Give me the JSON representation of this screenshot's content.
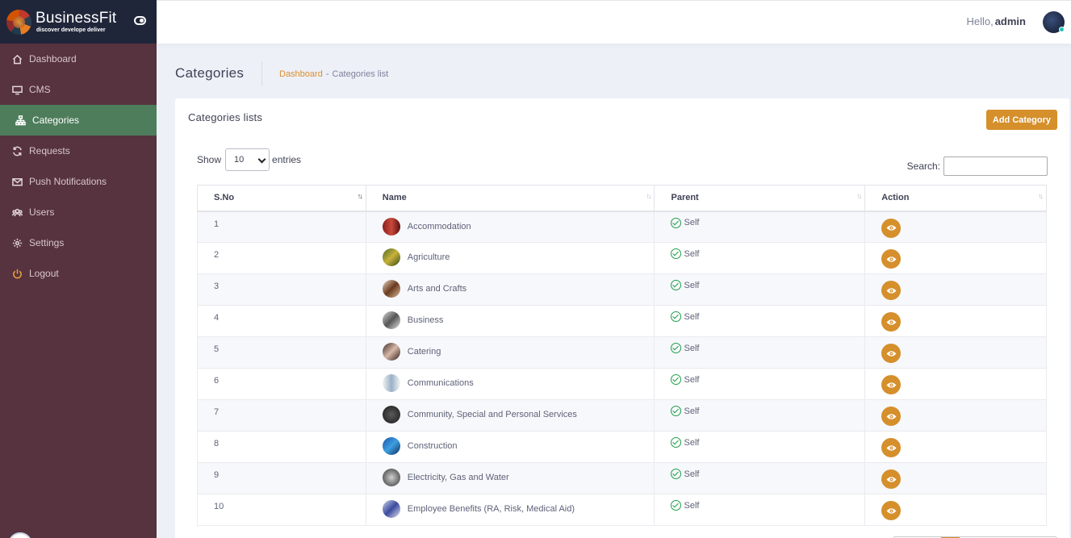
{
  "brand": {
    "name": "BusinessFit",
    "tagline": "discover develope deliver"
  },
  "sidebar": {
    "items": [
      {
        "label": "Dashboard",
        "icon": "home-icon"
      },
      {
        "label": "CMS",
        "icon": "monitor-icon"
      },
      {
        "label": "Categories",
        "icon": "sitemap-icon",
        "active": true
      },
      {
        "label": "Requests",
        "icon": "refresh-icon"
      },
      {
        "label": "Push Notifications",
        "icon": "envelope-icon"
      },
      {
        "label": "Users",
        "icon": "users-icon"
      },
      {
        "label": "Settings",
        "icon": "gear-icon"
      },
      {
        "label": "Logout",
        "icon": "power-icon"
      }
    ]
  },
  "header": {
    "hello": "Hello,",
    "username": "admin"
  },
  "subheader": {
    "title": "Categories",
    "breadcrumb_link": "Dashboard",
    "breadcrumb_sep": "-",
    "breadcrumb_current": "Categories list"
  },
  "card": {
    "title": "Categories lists",
    "add_label": "Add Category",
    "show_label": "Show",
    "entries_value": "10",
    "entries_label": "entries",
    "search_label": "Search:"
  },
  "table": {
    "columns": [
      "S.No",
      "Name",
      "Parent",
      "Action"
    ],
    "rows": [
      {
        "sno": "1",
        "name": "Accommodation",
        "parent": "Self"
      },
      {
        "sno": "2",
        "name": "Agriculture",
        "parent": "Self"
      },
      {
        "sno": "3",
        "name": "Arts and Crafts",
        "parent": "Self"
      },
      {
        "sno": "4",
        "name": "Business",
        "parent": "Self"
      },
      {
        "sno": "5",
        "name": "Catering",
        "parent": "Self"
      },
      {
        "sno": "6",
        "name": "Communications",
        "parent": "Self"
      },
      {
        "sno": "7",
        "name": "Community, Special and Personal Services",
        "parent": "Self"
      },
      {
        "sno": "8",
        "name": "Construction",
        "parent": "Self"
      },
      {
        "sno": "9",
        "name": "Electricity, Gas and Water",
        "parent": "Self"
      },
      {
        "sno": "10",
        "name": "Employee Benefits (RA, Risk, Medical Aid)",
        "parent": "Self"
      }
    ]
  },
  "colors": {
    "sidebar": "#56333f",
    "brand_bar": "#20263a",
    "active_nav": "#4e7d5b",
    "accent": "#d58f2b",
    "check": "#1e9e4a"
  }
}
